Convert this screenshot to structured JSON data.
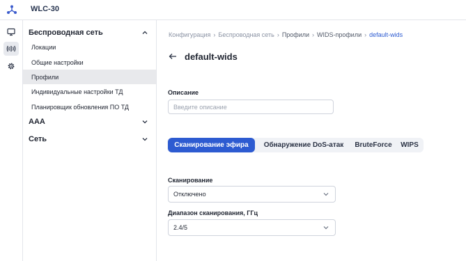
{
  "app": {
    "title": "WLC-30"
  },
  "rail": {
    "items": [
      "monitor-icon",
      "wireless-icon",
      "gear-icon"
    ]
  },
  "sidebar": {
    "groups": [
      {
        "label": "Беспроводная сеть",
        "expanded": true
      },
      {
        "label": "AAA",
        "expanded": false
      },
      {
        "label": "Сеть",
        "expanded": false
      }
    ],
    "items": [
      {
        "label": "Локации"
      },
      {
        "label": "Общие настройки"
      },
      {
        "label": "Профили"
      },
      {
        "label": "Индивидуальные настройки ТД"
      },
      {
        "label": "Планировщик обновления ПО ТД"
      }
    ]
  },
  "breadcrumb": [
    "Конфигурация",
    "Беспроводная сеть",
    "Профили",
    "WIDS-профили",
    "default-wids"
  ],
  "page": {
    "title": "default-wids"
  },
  "form": {
    "description_label": "Описание",
    "description_placeholder": "Введите описание",
    "tabs": [
      "Сканирование эфира",
      "Обнаружение DoS-атак",
      "BruteForce",
      "WIPS"
    ],
    "scan_label": "Сканирование",
    "scan_value": "Отключено",
    "range_label": "Диапазон сканирования, ГГц",
    "range_value": "2.4/5"
  },
  "colors": {
    "accent": "#2d5bd1",
    "selected_bg": "#e8e9ec"
  }
}
